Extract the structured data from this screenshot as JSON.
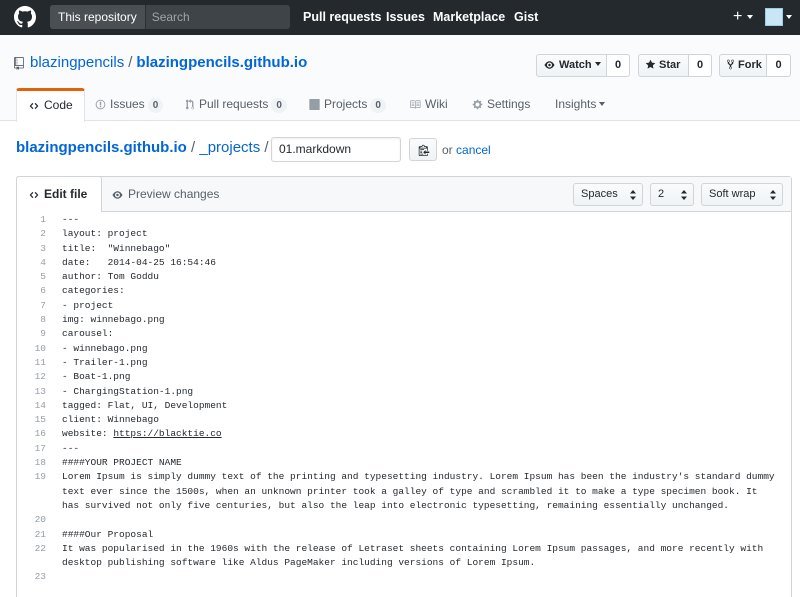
{
  "header": {
    "search_scope": "This repository",
    "search_placeholder": "Search",
    "nav": [
      "Pull requests",
      "Issues",
      "Marketplace",
      "Gist"
    ],
    "plus": "+"
  },
  "repo": {
    "owner": "blazingpencils",
    "separator": "/",
    "name": "blazingpencils.github.io",
    "watch_label": "Watch",
    "watch_count": "0",
    "star_label": "Star",
    "star_count": "0",
    "fork_label": "Fork",
    "fork_count": "0"
  },
  "tabs": {
    "code": "Code",
    "issues": "Issues",
    "issues_count": "0",
    "pulls": "Pull requests",
    "pulls_count": "0",
    "projects": "Projects",
    "projects_count": "0",
    "wiki": "Wiki",
    "settings": "Settings",
    "insights": "Insights"
  },
  "breadcrumb": {
    "repo": "blazingpencils.github.io",
    "slash1": "/",
    "dir": "_projects",
    "slash2": "/",
    "filename": "01.markdown",
    "or_text": "or",
    "cancel": "cancel"
  },
  "editor": {
    "edit_tab": "Edit file",
    "preview_tab": "Preview changes",
    "indent_mode": "Spaces",
    "indent_size": "2",
    "wrap_mode": "Soft wrap",
    "lines": [
      {
        "n": "1",
        "t": "---"
      },
      {
        "n": "2",
        "t": "layout: project"
      },
      {
        "n": "3",
        "t": "title:  \"Winnebago\""
      },
      {
        "n": "4",
        "t": "date:   2014-04-25 16:54:46"
      },
      {
        "n": "5",
        "t": "author: Tom Goddu"
      },
      {
        "n": "6",
        "t": "categories:"
      },
      {
        "n": "7",
        "t": "- project"
      },
      {
        "n": "8",
        "t": "img: winnebago.png"
      },
      {
        "n": "9",
        "t": "carousel:"
      },
      {
        "n": "10",
        "t": "- winnebago.png"
      },
      {
        "n": "11",
        "t": "- Trailer-1.png"
      },
      {
        "n": "12",
        "t": "- Boat-1.png"
      },
      {
        "n": "13",
        "t": "- ChargingStation-1.png"
      },
      {
        "n": "14",
        "t": "tagged: Flat, UI, Development"
      },
      {
        "n": "15",
        "t": "client: Winnebago"
      },
      {
        "n": "16",
        "t": "website: ",
        "link": "https://blacktie.co"
      },
      {
        "n": "17",
        "t": "---"
      },
      {
        "n": "18",
        "t": "####YOUR PROJECT NAME"
      },
      {
        "n": "19",
        "t": "Lorem Ipsum is simply dummy text of the printing and typesetting industry. Lorem Ipsum has been the industry's standard dummy text ever since the 1500s, when an unknown printer took a galley of type and scrambled it to make a type specimen book. It has survived not only five centuries, but also the leap into electronic typesetting, remaining essentially unchanged."
      },
      {
        "n": "20",
        "t": ""
      },
      {
        "n": "21",
        "t": "####Our Proposal"
      },
      {
        "n": "22",
        "t": "It was popularised in the 1960s with the release of Letraset sheets containing Lorem Ipsum passages, and more recently with desktop publishing software like Aldus PageMaker including versions of Lorem Ipsum."
      },
      {
        "n": "23",
        "t": ""
      }
    ]
  }
}
